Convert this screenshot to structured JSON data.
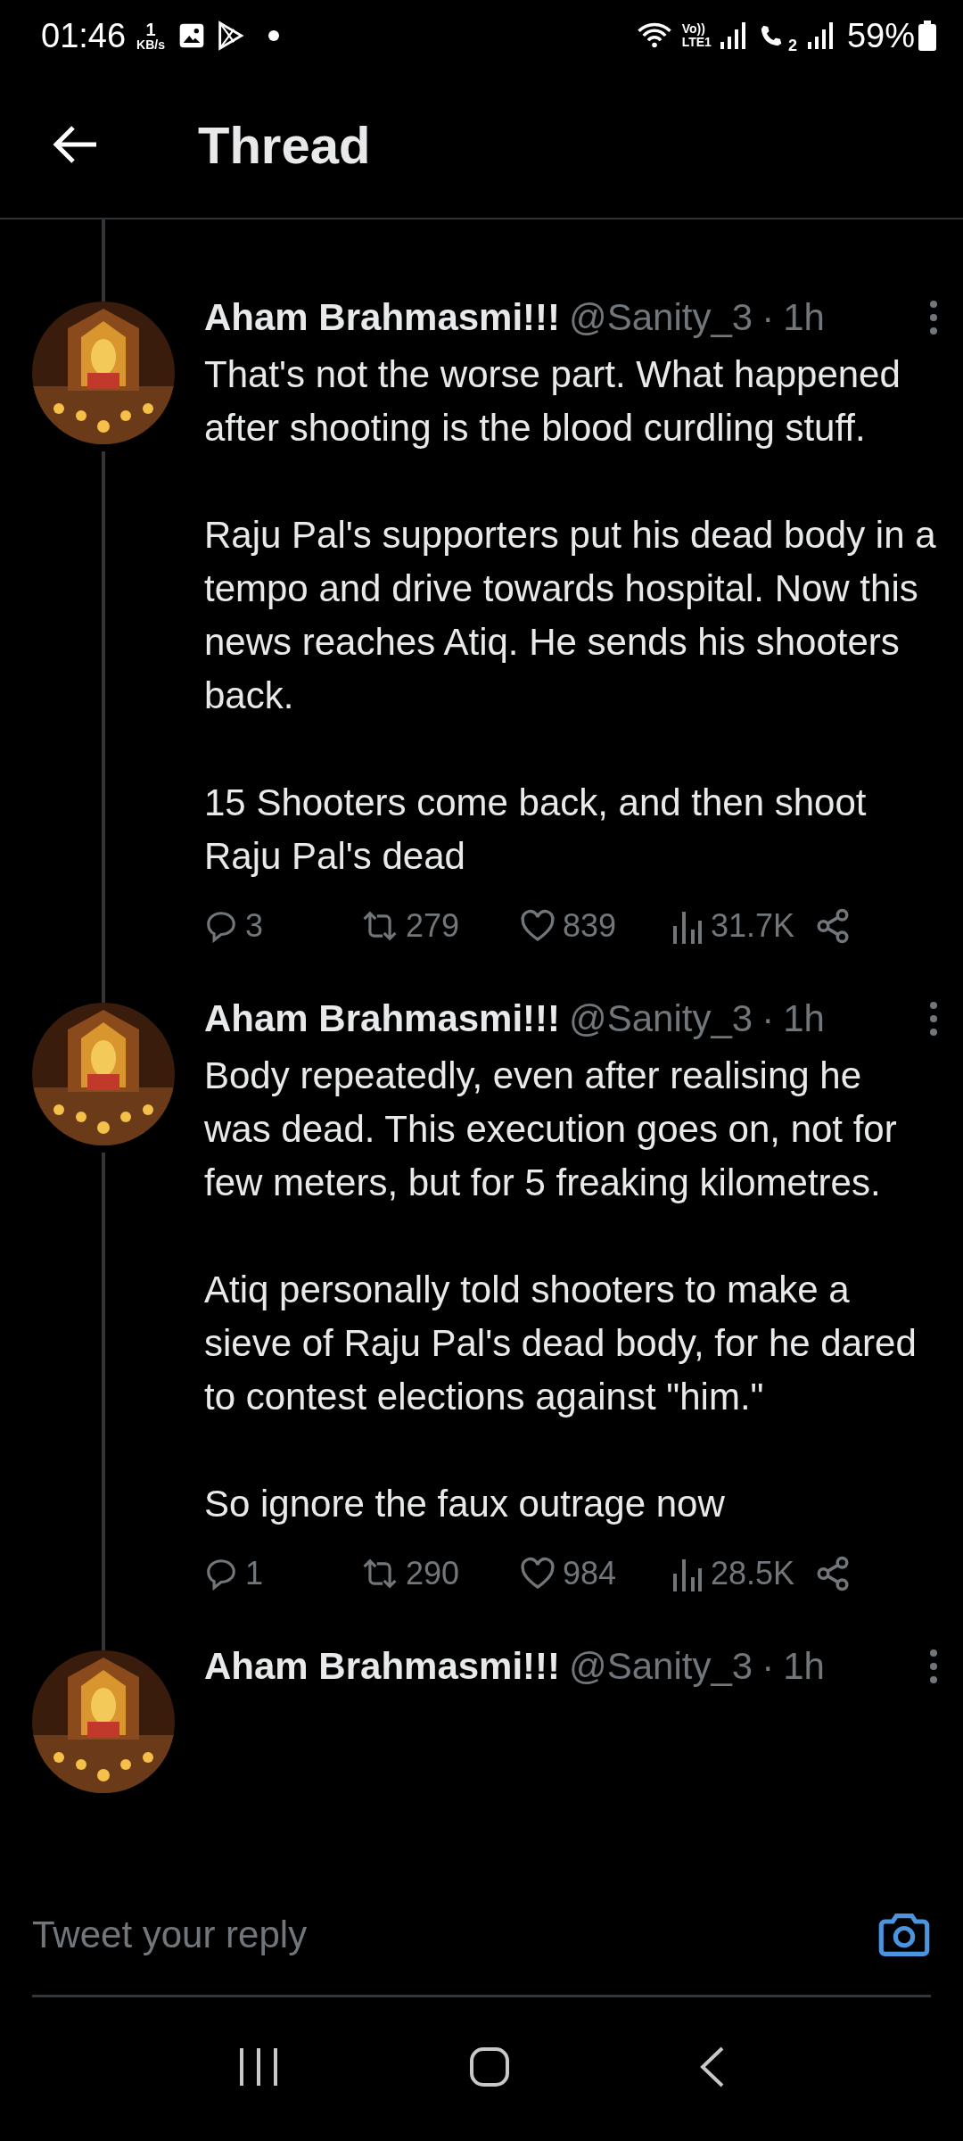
{
  "status_bar": {
    "time": "01:46",
    "net_speed": "1",
    "net_unit": "KB/s",
    "volte": "Vo))",
    "lte": "LTE1",
    "sim2": "2",
    "battery": "59%"
  },
  "header": {
    "title": "Thread"
  },
  "tweets": [
    {
      "author": "Aham Brahmasmi!!!",
      "handle": "@Sanity_3",
      "separator": "·",
      "time": "1h",
      "paragraphs": [
        "That's not the worse part. What happened after shooting is the blood curdling stuff.",
        "Raju Pal's supporters put his dead body in a tempo and drive towards hospital. Now this news reaches Atiq. He sends his shooters back.",
        "15 Shooters come back, and then shoot Raju Pal's dead"
      ],
      "stats": {
        "replies": "3",
        "retweets": "279",
        "likes": "839",
        "views": "31.7K"
      }
    },
    {
      "author": "Aham Brahmasmi!!!",
      "handle": "@Sanity_3",
      "separator": "·",
      "time": "1h",
      "paragraphs": [
        "Body repeatedly, even after realising he was dead. This execution goes on, not for few meters, but for 5 freaking kilometres.",
        "Atiq personally told shooters to make a sieve of Raju Pal's dead body, for he dared to contest elections against \"him.\"",
        "So ignore the faux outrage now"
      ],
      "stats": {
        "replies": "1",
        "retweets": "290",
        "likes": "984",
        "views": "28.5K"
      }
    },
    {
      "author": "Aham Brahmasmi!!!",
      "handle": "@Sanity_3",
      "separator": "·",
      "time": "1h"
    }
  ],
  "reply_bar": {
    "placeholder": "Tweet your reply"
  }
}
